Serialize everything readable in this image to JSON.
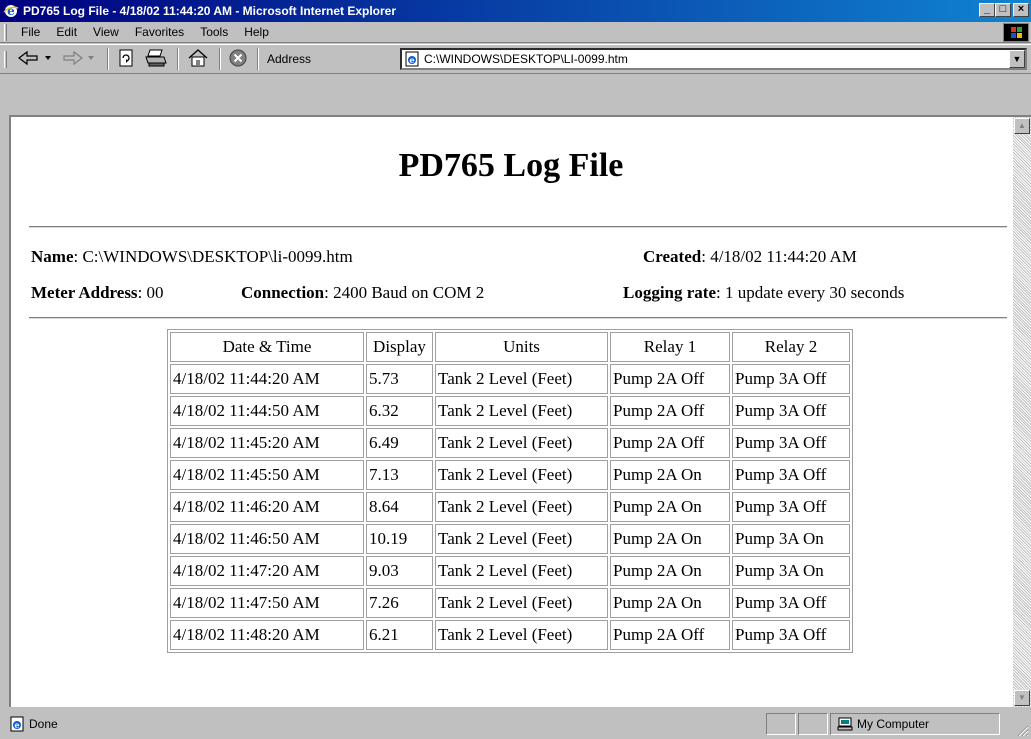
{
  "window": {
    "title": "PD765 Log File - 4/18/02 11:44:20 AM - Microsoft Internet Explorer",
    "btn_minimize": "_",
    "btn_maximize": "□",
    "btn_close": "×"
  },
  "menu": {
    "items": [
      {
        "label": "File"
      },
      {
        "label": "Edit"
      },
      {
        "label": "View"
      },
      {
        "label": "Favorites"
      },
      {
        "label": "Tools"
      },
      {
        "label": "Help"
      }
    ]
  },
  "toolbar": {
    "address_label": "Address",
    "address_value": "C:\\WINDOWS\\DESKTOP\\LI-0099.htm",
    "icons": [
      "back-icon",
      "forward-icon",
      "refresh-icon",
      "print-icon",
      "home-icon",
      "stop-icon"
    ]
  },
  "page": {
    "title": "PD765 Log File",
    "name_label": "Name",
    "name_value": ": C:\\WINDOWS\\DESKTOP\\li-0099.htm",
    "created_label": "Created",
    "created_value": ": 4/18/02 11:44:20 AM",
    "meter_label": "Meter Address",
    "meter_value": ": 00",
    "connection_label": "Connection",
    "connection_value": ": 2400 Baud on COM 2",
    "logging_label": "Logging rate",
    "logging_value": ": 1 update every 30 seconds"
  },
  "table": {
    "headers": [
      "Date & Time",
      "Display",
      "Units",
      "Relay 1",
      "Relay 2"
    ],
    "rows": [
      [
        "4/18/02 11:44:20 AM",
        "5.73",
        "Tank 2 Level (Feet)",
        "Pump 2A Off",
        "Pump 3A Off"
      ],
      [
        "4/18/02 11:44:50 AM",
        "6.32",
        "Tank 2 Level (Feet)",
        "Pump 2A Off",
        "Pump 3A Off"
      ],
      [
        "4/18/02 11:45:20 AM",
        "6.49",
        "Tank 2 Level (Feet)",
        "Pump 2A Off",
        "Pump 3A Off"
      ],
      [
        "4/18/02 11:45:50 AM",
        "7.13",
        "Tank 2 Level (Feet)",
        "Pump 2A On",
        "Pump 3A Off"
      ],
      [
        "4/18/02 11:46:20 AM",
        "8.64",
        "Tank 2 Level (Feet)",
        "Pump 2A On",
        "Pump 3A Off"
      ],
      [
        "4/18/02 11:46:50 AM",
        "10.19",
        "Tank 2 Level (Feet)",
        "Pump 2A On",
        "Pump 3A On"
      ],
      [
        "4/18/02 11:47:20 AM",
        "9.03",
        "Tank 2 Level (Feet)",
        "Pump 2A On",
        "Pump 3A On"
      ],
      [
        "4/18/02 11:47:50 AM",
        "7.26",
        "Tank 2 Level (Feet)",
        "Pump 2A On",
        "Pump 3A Off"
      ],
      [
        "4/18/02 11:48:20 AM",
        "6.21",
        "Tank 2 Level (Feet)",
        "Pump 2A Off",
        "Pump 3A Off"
      ]
    ]
  },
  "status": {
    "left": "Done",
    "zone": "My Computer"
  },
  "colors": {
    "titlebar_start": "#00007e",
    "titlebar_end": "#1084d0",
    "chrome": "#c0c0c0"
  }
}
